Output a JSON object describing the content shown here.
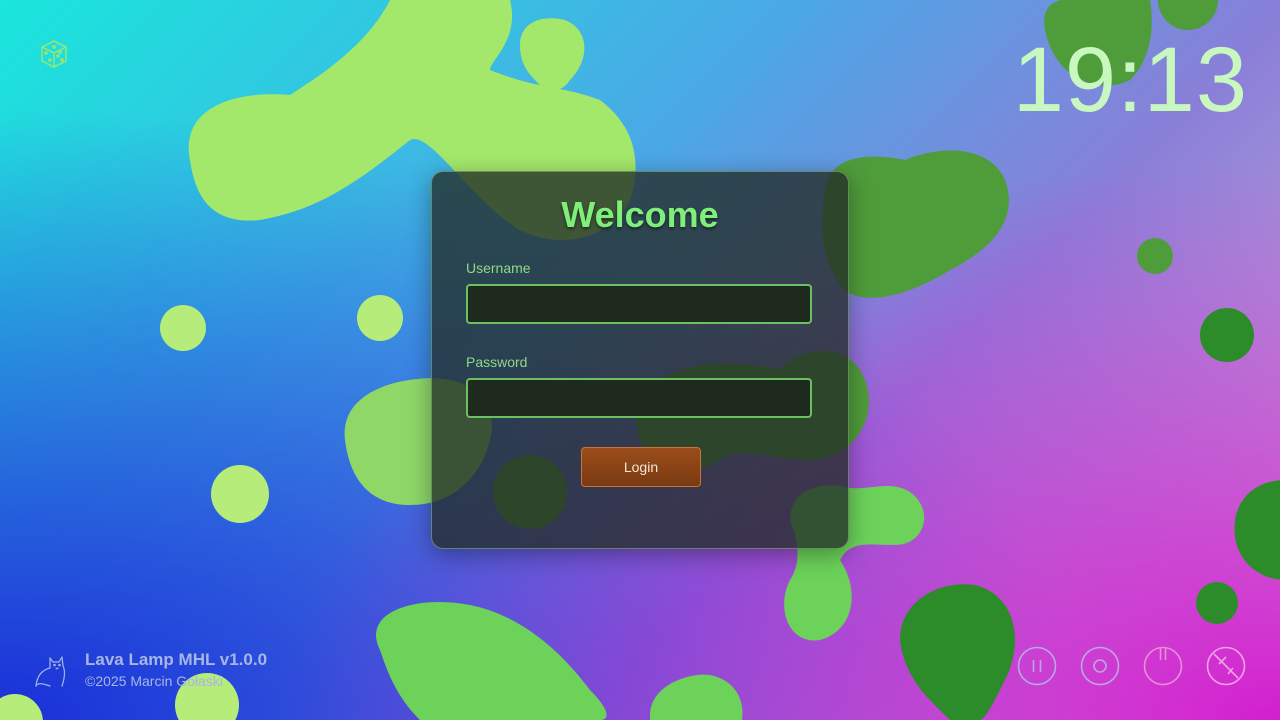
{
  "clock": {
    "time": "19:13"
  },
  "login": {
    "title": "Welcome",
    "username_label": "Username",
    "username_value": "",
    "password_label": "Password",
    "password_value": "",
    "login_button": "Login"
  },
  "footer": {
    "app_name": "Lava Lamp MHL v1.0.0",
    "copyright": "©2025 Marcin Gołaski"
  },
  "icons": {
    "top_left": "dice-icon",
    "footer_logo": "cat-icon",
    "controls": [
      "pause-icon",
      "record-icon",
      "power-icon",
      "no-sleep-icon"
    ]
  },
  "colors": {
    "accent_green": "#7ef07a",
    "clock": "#c9f7c0",
    "login_button": "#8a4418",
    "power_pink": "#e58fd8"
  }
}
